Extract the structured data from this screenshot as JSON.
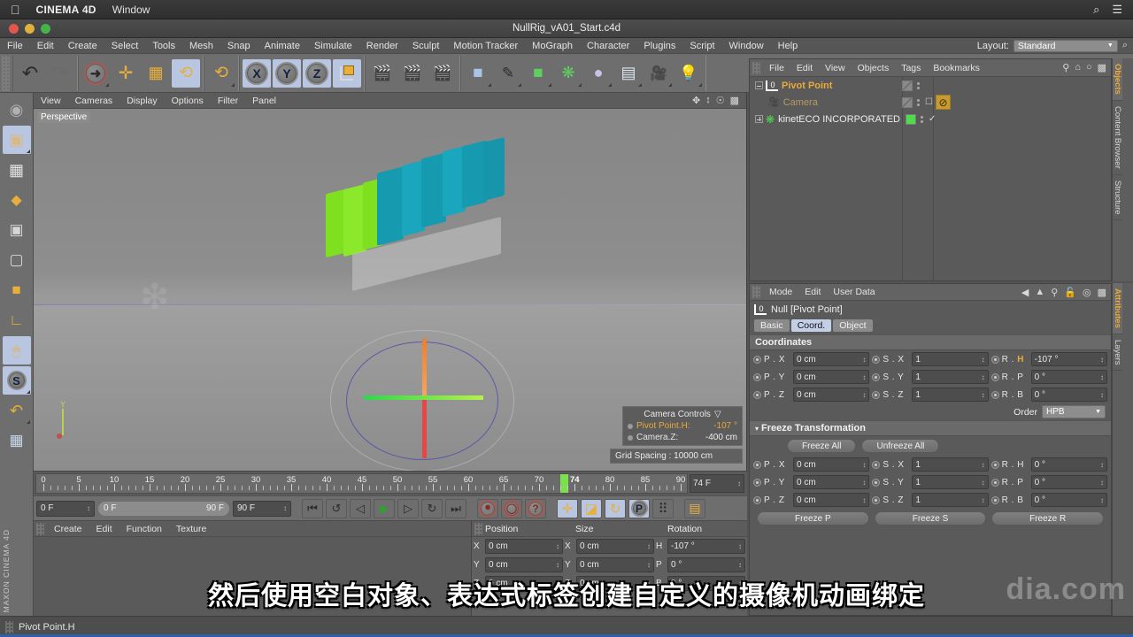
{
  "os_bar": {
    "apple_glyph": "",
    "app_name": "CINEMA 4D",
    "menu": "Window",
    "search_icon": "⌕",
    "list_icon": "☰"
  },
  "title_bar": {
    "document_title": "NullRig_vA01_Start.c4d"
  },
  "main_menu": {
    "items": [
      "File",
      "Edit",
      "Create",
      "Select",
      "Tools",
      "Mesh",
      "Snap",
      "Animate",
      "Simulate",
      "Render",
      "Sculpt",
      "Motion Tracker",
      "MoGraph",
      "Character",
      "Plugins",
      "Script",
      "Window",
      "Help"
    ],
    "layout_label": "Layout:",
    "layout_value": "Standard",
    "search_icon": "⌕"
  },
  "toolbar": {
    "groups": [
      {
        "items": [
          {
            "name": "undo-icon",
            "glyph": "↶",
            "selected": false
          },
          {
            "name": "redo-icon",
            "glyph": "↷",
            "selected": false
          }
        ]
      },
      {
        "items": [
          {
            "name": "live-selection-icon",
            "glyph": "➚",
            "selected": false
          },
          {
            "name": "move-tool-icon",
            "glyph": "✛",
            "selected": false
          },
          {
            "name": "scale-tool-icon",
            "glyph": "◪",
            "selected": false
          },
          {
            "name": "rotate-tool-icon",
            "glyph": "↻",
            "selected": true
          }
        ]
      },
      {
        "items": [
          {
            "name": "rotate-alt-icon",
            "glyph": "↻",
            "selected": false
          }
        ]
      },
      {
        "items": [
          {
            "name": "axis-x-icon",
            "glyph": "X",
            "selected": true
          },
          {
            "name": "axis-y-icon",
            "glyph": "Y",
            "selected": true
          },
          {
            "name": "axis-z-icon",
            "glyph": "Z",
            "selected": true
          },
          {
            "name": "world-object-axis-icon",
            "glyph": "⬛",
            "selected": true
          }
        ]
      },
      {
        "items": [
          {
            "name": "render-view-icon",
            "glyph": "🎬",
            "selected": false
          },
          {
            "name": "render-region-icon",
            "glyph": "🎬",
            "selected": false
          },
          {
            "name": "render-settings-icon",
            "glyph": "🎬",
            "selected": false
          }
        ]
      },
      {
        "items": [
          {
            "name": "primitive-cube-icon",
            "glyph": "⬛",
            "selected": false
          },
          {
            "name": "spline-pen-icon",
            "glyph": "✎",
            "selected": false
          },
          {
            "name": "generator-icon",
            "glyph": "⬛",
            "selected": false
          },
          {
            "name": "deformer-icon",
            "glyph": "❋",
            "selected": false
          },
          {
            "name": "scene-environment-icon",
            "glyph": "◯",
            "selected": false
          },
          {
            "name": "scene-floor-icon",
            "glyph": "▤",
            "selected": false
          },
          {
            "name": "camera-icon",
            "glyph": "🎥",
            "selected": false
          },
          {
            "name": "light-icon",
            "glyph": "💡",
            "selected": false
          }
        ]
      }
    ]
  },
  "left_toolbar": {
    "items": [
      {
        "name": "mode-world-icon",
        "glyph": "◍",
        "selected": false
      },
      {
        "name": "mode-object-icon",
        "glyph": "▣",
        "selected": true
      },
      {
        "name": "mode-texture-icon",
        "glyph": "▦",
        "selected": false
      },
      {
        "name": "mode-deformer-icon",
        "glyph": "◆",
        "selected": false
      },
      {
        "name": "mode-points-icon",
        "glyph": "▣",
        "selected": false
      },
      {
        "name": "mode-edges-icon",
        "glyph": "▢",
        "selected": false
      },
      {
        "name": "mode-polygons-icon",
        "glyph": "◼",
        "selected": false
      },
      {
        "name": "axis-modify-icon",
        "glyph": "L",
        "selected": false
      },
      {
        "name": "enable-snapping-icon",
        "glyph": "🖱",
        "selected": true
      },
      {
        "name": "snap-settings-icon",
        "glyph": "S",
        "selected": true
      },
      {
        "name": "magnet-tool-icon",
        "glyph": "U",
        "selected": false
      },
      {
        "name": "workplane-icon",
        "glyph": "▨",
        "selected": false
      }
    ],
    "brand": "MAXON CINEMA 4D"
  },
  "viewport": {
    "menu": [
      "View",
      "Cameras",
      "Display",
      "Options",
      "Filter",
      "Panel"
    ],
    "corner_icons": [
      "pan-view-icon",
      "zoom-view-icon",
      "rotate-view-icon",
      "maximize-view-icon"
    ],
    "label": "Perspective",
    "camera_controls": {
      "title": "Camera Controls",
      "collapse_glyph": "▽",
      "rows": [
        {
          "label": "Pivot Point.H:",
          "value": "-107 °",
          "highlight": true
        },
        {
          "label": "Camera.Z:",
          "value": "-400 cm",
          "highlight": false
        }
      ]
    },
    "grid_spacing": "Grid Spacing : 10000 cm",
    "object_colors": {
      "green": "#7ee01f",
      "teal": "#169ab0",
      "gray": "#b9b9b9"
    }
  },
  "timeline": {
    "ticks": [
      "0",
      "5",
      "10",
      "15",
      "20",
      "25",
      "30",
      "35",
      "40",
      "45",
      "50",
      "55",
      "60",
      "65",
      "70",
      "80",
      "85",
      "90"
    ],
    "playhead_frame": "74",
    "current_frame_field": "74 F",
    "range_start": "0 F",
    "range_min": "0 F",
    "range_max": "90 F",
    "range_end": "90 F",
    "transport_buttons": [
      {
        "name": "go-to-start-button",
        "glyph": "⏮"
      },
      {
        "name": "previous-key-button",
        "glyph": "↺"
      },
      {
        "name": "step-back-button",
        "glyph": "◁"
      },
      {
        "name": "play-button",
        "glyph": "▶"
      },
      {
        "name": "step-forward-button",
        "glyph": "▷"
      },
      {
        "name": "next-key-button",
        "glyph": "↻"
      },
      {
        "name": "go-to-end-button",
        "glyph": "⏭"
      }
    ],
    "record_buttons": [
      {
        "name": "record-active-objects-button",
        "glyph": "⏺"
      },
      {
        "name": "autokeying-button",
        "glyph": "◯"
      },
      {
        "name": "keyframe-selection-button",
        "glyph": "?"
      }
    ],
    "key_mode_buttons": [
      {
        "name": "position-key-icon",
        "glyph": "✛",
        "selected": true
      },
      {
        "name": "scale-key-icon",
        "glyph": "◪",
        "selected": true
      },
      {
        "name": "rotation-key-icon",
        "glyph": "↻",
        "selected": true
      },
      {
        "name": "parameter-key-icon",
        "glyph": "P",
        "selected": true
      },
      {
        "name": "pla-key-icon",
        "glyph": "⠿",
        "selected": false
      }
    ],
    "timeline-toggle": {
      "name": "animation-layer-icon",
      "glyph": "▤"
    }
  },
  "material_manager": {
    "menu": [
      "Create",
      "Edit",
      "Function",
      "Texture"
    ]
  },
  "coordinate_manager": {
    "columns": [
      "Position",
      "Size",
      "Rotation"
    ],
    "rows": [
      {
        "pos_label": "X",
        "pos_value": "0 cm",
        "size_label": "X",
        "size_value": "0 cm",
        "rot_label": "H",
        "rot_value": "-107 °"
      },
      {
        "pos_label": "Y",
        "pos_value": "0 cm",
        "size_label": "Y",
        "size_value": "0 cm",
        "rot_label": "P",
        "rot_value": "0 °"
      },
      {
        "pos_label": "Z",
        "pos_value": "0 cm",
        "size_label": "Z",
        "size_value": "0 cm",
        "rot_label": "B",
        "rot_value": "0 °"
      }
    ]
  },
  "object_manager": {
    "menu": [
      "File",
      "Edit",
      "View",
      "Objects",
      "Tags",
      "Bookmarks"
    ],
    "header_icons": [
      "search-icon",
      "home-icon",
      "eye-icon",
      "expand-icon"
    ],
    "rows": [
      {
        "name": "Pivot Point",
        "type": "null",
        "depth": 0,
        "color_class": "pivot",
        "expander": "minus",
        "tag": null
      },
      {
        "name": "Camera",
        "type": "camera",
        "depth": 1,
        "color_class": "cam",
        "expander": "none",
        "tag": "expression-tag"
      },
      {
        "name": "kinetECO INCORPORATED",
        "type": "mesh",
        "depth": 0,
        "color_class": "mesh",
        "expander": "plus",
        "tag": null
      }
    ],
    "tabs": [
      {
        "label": "Objects",
        "selected": true
      },
      {
        "label": "Content Browser",
        "selected": false
      },
      {
        "label": "Structure",
        "selected": false
      }
    ]
  },
  "attribute_manager": {
    "menu": [
      "Mode",
      "Edit",
      "User Data"
    ],
    "header_icons": [
      "back-arrow-icon",
      "up-arrow-icon",
      "search-icon",
      "lock-icon",
      "target-icon",
      "expand-icon"
    ],
    "object_title": "Null [Pivot Point]",
    "tabs": [
      {
        "label": "Basic",
        "selected": false
      },
      {
        "label": "Coord.",
        "selected": true
      },
      {
        "label": "Object",
        "selected": false
      }
    ],
    "coordinates_title": "Coordinates",
    "coord_rows": [
      {
        "p_label": "P . X",
        "p_value": "0 cm",
        "s_label": "S . X",
        "s_value": "1",
        "r_label": "R . ",
        "r_hl": "H",
        "r_value": "-107 °"
      },
      {
        "p_label": "P . Y",
        "p_value": "0 cm",
        "s_label": "S . Y",
        "s_value": "1",
        "r_label": "R . P",
        "r_hl": "",
        "r_value": "0 °"
      },
      {
        "p_label": "P . Z",
        "p_value": "0 cm",
        "s_label": "S . Z",
        "s_value": "1",
        "r_label": "R . B",
        "r_hl": "",
        "r_value": "0 °"
      }
    ],
    "order_label": "Order",
    "order_value": "HPB",
    "freeze_title": "Freeze Transformation",
    "freeze_all": "Freeze All",
    "unfreeze_all": "Unfreeze All",
    "freeze_rows": [
      {
        "p_label": "P . X",
        "p_value": "0 cm",
        "s_label": "S . X",
        "s_value": "1",
        "r_label": "R . H",
        "r_value": "0 °"
      },
      {
        "p_label": "P . Y",
        "p_value": "0 cm",
        "s_label": "S . Y",
        "s_value": "1",
        "r_label": "R . P",
        "r_value": "0 °"
      },
      {
        "p_label": "P . Z",
        "p_value": "0 cm",
        "s_label": "S . Z",
        "s_value": "1",
        "r_label": "R . B",
        "r_value": "0 °"
      }
    ],
    "freeze_p": "Freeze P",
    "freeze_s": "Freeze S",
    "freeze_r": "Freeze R",
    "tabs_right": [
      {
        "label": "Attributes",
        "selected": true
      },
      {
        "label": "Layers",
        "selected": false
      }
    ]
  },
  "status_bar": {
    "message": "Pivot Point.H"
  },
  "subtitle": {
    "text": "然后使用空白对象、表达式标签创建自定义的摄像机动画绑定"
  },
  "watermark": {
    "text": "dia.com"
  }
}
